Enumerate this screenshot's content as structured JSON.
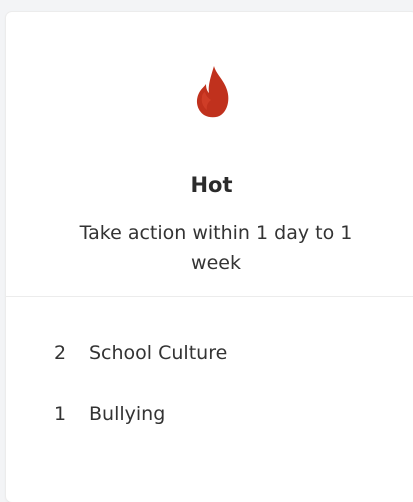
{
  "card": {
    "icon": "flame-icon",
    "icon_color": "#c0311d",
    "title": "Hot",
    "description": "Take action within 1 day to 1 week"
  },
  "topics": [
    {
      "count": "2",
      "label": "School Culture"
    },
    {
      "count": "1",
      "label": "Bullying"
    }
  ]
}
